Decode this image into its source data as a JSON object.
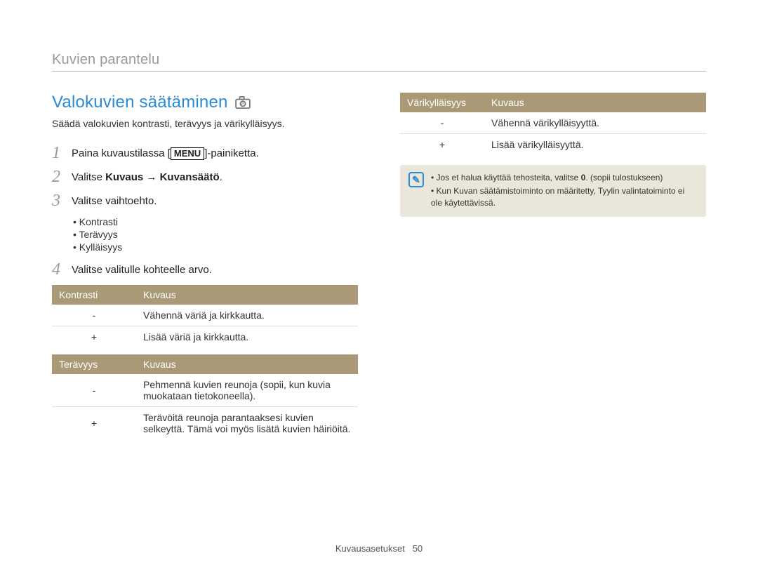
{
  "header": {
    "breadcrumb": "Kuvien parantelu"
  },
  "left": {
    "title": "Valokuvien säätäminen",
    "intro": "Säädä valokuvien kontrasti, terävyys ja värikylläisyys.",
    "steps": {
      "s1": {
        "num": "1",
        "pre": "Paina kuvaustilassa [",
        "menu": "MENU",
        "post": "]-painiketta."
      },
      "s2": {
        "num": "2",
        "pre": "Valitse ",
        "bold": "Kuvaus → Kuvansäätö",
        "post": "."
      },
      "s3": {
        "num": "3",
        "text": "Valitse vaihtoehto."
      },
      "s4": {
        "num": "4",
        "text": "Valitse valitulle kohteelle arvo."
      }
    },
    "bullets": {
      "b1": "Kontrasti",
      "b2": "Terävyys",
      "b3": "Kylläisyys"
    },
    "table_kontrasti": {
      "hdr1": "Kontrasti",
      "hdr2": "Kuvaus",
      "r1c1": "-",
      "r1c2": "Vähennä väriä ja kirkkautta.",
      "r2c1": "+",
      "r2c2": "Lisää väriä ja kirkkautta."
    },
    "table_teravyys": {
      "hdr1": "Terävyys",
      "hdr2": "Kuvaus",
      "r1c1": "-",
      "r1c2": "Pehmennä kuvien reunoja (sopii, kun kuvia muokataan tietokoneella).",
      "r2c1": "+",
      "r2c2": "Terävöitä reunoja parantaaksesi kuvien selkeyttä. Tämä voi myös lisätä kuvien häiriöitä."
    }
  },
  "right": {
    "table_varikyl": {
      "hdr1": "Värikylläisyys",
      "hdr2": "Kuvaus",
      "r1c1": "-",
      "r1c2": "Vähennä värikylläisyyttä.",
      "r2c1": "+",
      "r2c2": "Lisää värikylläisyyttä."
    },
    "note": {
      "n1a": "Jos et halua käyttää tehosteita, valitse ",
      "n1b": "0",
      "n1c": ". (sopii tulostukseen)",
      "n2": "Kun Kuvan säätämistoiminto on määritetty, Tyylin valintatoiminto ei ole käytettävissä."
    }
  },
  "footer": {
    "section": "Kuvausasetukset",
    "page": "50"
  }
}
